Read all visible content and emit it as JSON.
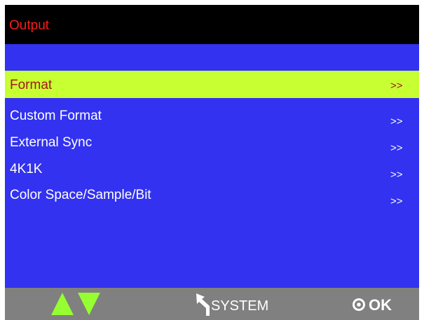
{
  "header": {
    "title": "Output"
  },
  "menu": {
    "items": [
      {
        "label": "Format",
        "arrow": ">>",
        "selected": true
      },
      {
        "label": "Custom Format",
        "arrow": ">>",
        "selected": false
      },
      {
        "label": "External Sync",
        "arrow": ">>",
        "selected": false
      },
      {
        "label": "4K1K",
        "arrow": ">>",
        "selected": false
      },
      {
        "label": "Color Space/Sample/Bit",
        "arrow": ">>",
        "selected": false
      }
    ]
  },
  "footer": {
    "up_icon": "triangle-up-icon",
    "down_icon": "triangle-down-icon",
    "back_icon": "return-arrow-icon",
    "system_label": "SYSTEM",
    "ok_icon": "circle-dot-icon",
    "ok_label": "OK"
  },
  "colors": {
    "screen_background": "#3232f0",
    "header_background": "#000000",
    "header_text": "#ff1a1a",
    "selected_background": "#c8ff32",
    "selected_text": "#a01818",
    "menu_text": "#ffffff",
    "footer_background": "#808080",
    "nav_arrow": "#96ff32"
  }
}
